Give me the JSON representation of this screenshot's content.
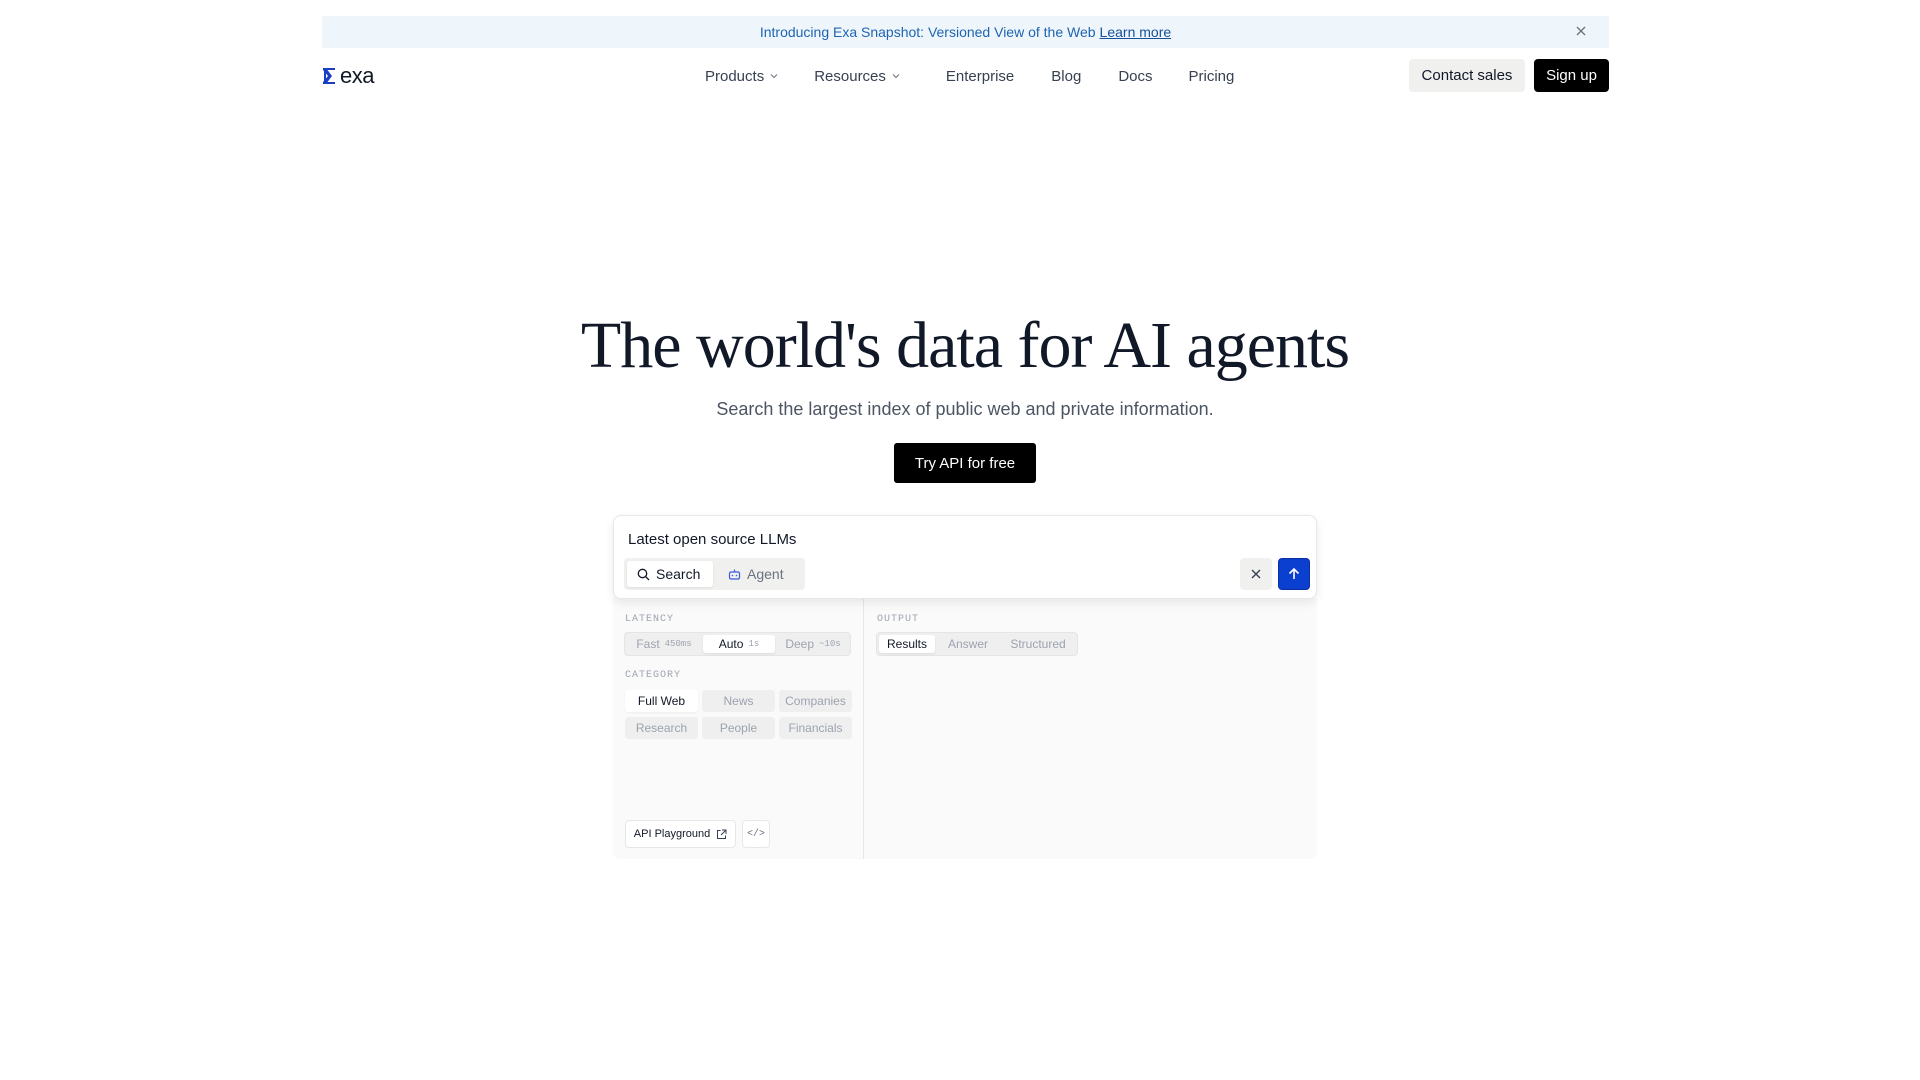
{
  "banner": {
    "title": "Introducing Exa Snapshot: Versioned View of the Web",
    "link": "Learn more",
    "close_icon": "close-icon"
  },
  "brand": {
    "name": "exa",
    "logo_icon": "exa-logo-icon",
    "accent": "#1a3fc4"
  },
  "nav": {
    "items": [
      {
        "label": "Products",
        "dropdown": true
      },
      {
        "label": "Resources",
        "dropdown": true
      },
      {
        "label": "Enterprise",
        "dropdown": false
      },
      {
        "label": "Blog",
        "dropdown": false
      },
      {
        "label": "Docs",
        "dropdown": false
      },
      {
        "label": "Pricing",
        "dropdown": false
      }
    ],
    "contact": "Contact sales",
    "signup": "Sign up"
  },
  "hero": {
    "title": "The world's data for AI agents",
    "subtitle": "Search the largest index of public web and private information.",
    "cta": "Try API for free"
  },
  "search": {
    "query": "Latest open source LLMs",
    "modes": [
      {
        "label": "Search",
        "icon": "search-icon",
        "active": true
      },
      {
        "label": "Agent",
        "icon": "robot-icon",
        "active": false
      }
    ],
    "submit_color": "#0b3fcf"
  },
  "options": {
    "latency": {
      "label": "LATENCY",
      "options": [
        {
          "label": "Fast",
          "tag": "450ms",
          "active": false
        },
        {
          "label": "Auto",
          "tag": "1s",
          "active": true
        },
        {
          "label": "Deep",
          "tag": "~10s",
          "active": false
        }
      ]
    },
    "category": {
      "label": "CATEGORY",
      "options": [
        {
          "label": "Full Web",
          "active": true
        },
        {
          "label": "News",
          "active": false
        },
        {
          "label": "Companies",
          "active": false
        },
        {
          "label": "Research",
          "active": false
        },
        {
          "label": "People",
          "active": false
        },
        {
          "label": "Financials",
          "active": false
        }
      ]
    },
    "output": {
      "label": "OUTPUT",
      "options": [
        {
          "label": "Results",
          "active": true
        },
        {
          "label": "Answer",
          "active": false
        },
        {
          "label": "Structured",
          "active": false
        }
      ]
    },
    "playground": "API Playground",
    "code": "</>"
  }
}
